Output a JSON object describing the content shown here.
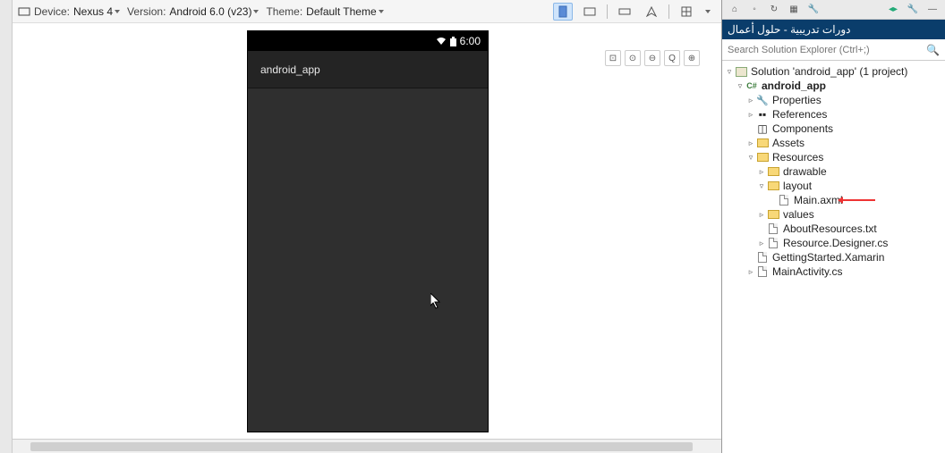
{
  "designer": {
    "device_label": "Device:",
    "device_value": "Nexus 4",
    "version_label": "Version:",
    "version_value": "Android 6.0 (v23)",
    "theme_label": "Theme:",
    "theme_value": "Default Theme"
  },
  "phone": {
    "time": "6:00",
    "app_title": "android_app"
  },
  "solution_panel": {
    "title_ar": "دورات تدريبية - حلول أعمال",
    "search_placeholder": "Search Solution Explorer (Ctrl+;)"
  },
  "tree": {
    "solution": "Solution 'android_app' (1 project)",
    "project": "android_app",
    "properties": "Properties",
    "references": "References",
    "components": "Components",
    "assets": "Assets",
    "resources": "Resources",
    "drawable": "drawable",
    "layout": "layout",
    "main_axml": "Main.axml",
    "values": "values",
    "about_resources": "AboutResources.txt",
    "resource_designer": "Resource.Designer.cs",
    "getting_started": "GettingStarted.Xamarin",
    "main_activity": "MainActivity.cs"
  }
}
